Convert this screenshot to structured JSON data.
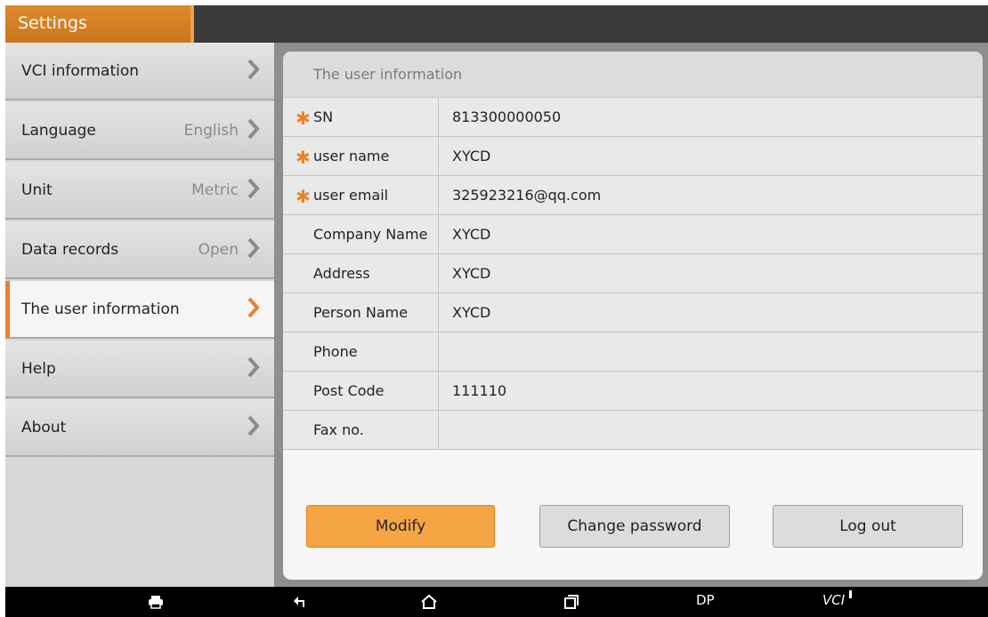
{
  "app": {
    "title": "Settings"
  },
  "sidebar": {
    "items": [
      {
        "label": "VCI information",
        "value": ""
      },
      {
        "label": "Language",
        "value": "English"
      },
      {
        "label": "Unit",
        "value": "Metric"
      },
      {
        "label": "Data records",
        "value": "Open"
      },
      {
        "label": "The user information",
        "value": "",
        "active": true
      },
      {
        "label": "Help",
        "value": ""
      },
      {
        "label": "About",
        "value": ""
      }
    ]
  },
  "panel": {
    "title": "The user information",
    "rows": [
      {
        "key": "SN",
        "value": "813300000050",
        "required": true
      },
      {
        "key": "user name",
        "value": "XYCD",
        "required": true
      },
      {
        "key": "user email",
        "value": "325923216@qq.com",
        "required": true
      },
      {
        "key": "Company Name",
        "value": "XYCD",
        "required": false
      },
      {
        "key": "Address",
        "value": "XYCD",
        "required": false
      },
      {
        "key": "Person Name",
        "value": "XYCD",
        "required": false
      },
      {
        "key": "Phone",
        "value": "",
        "required": false
      },
      {
        "key": "Post Code",
        "value": "111110",
        "required": false
      },
      {
        "key": "Fax no.",
        "value": "",
        "required": false
      }
    ],
    "buttons": {
      "modify": "Modify",
      "change_password": "Change password",
      "logout": "Log out"
    }
  },
  "navbar": {
    "dp": "DP",
    "vci": "VCI"
  },
  "colors": {
    "accent": "#e9822a",
    "button_primary": "#f6a545"
  }
}
